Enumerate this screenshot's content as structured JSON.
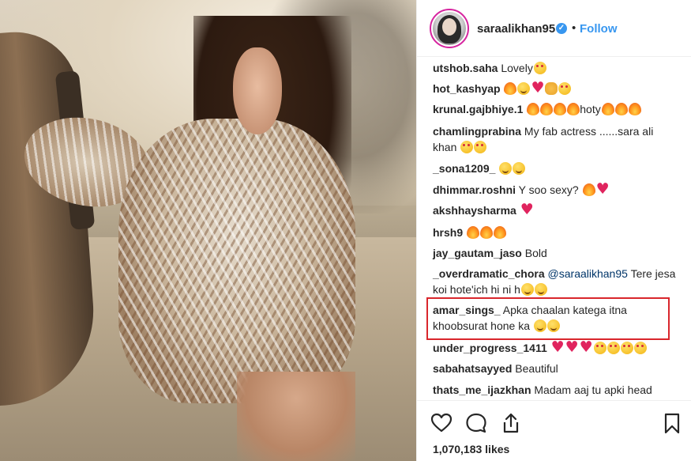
{
  "post": {
    "username": "saraalikhan95",
    "verified_mark": "✓",
    "separator": "•",
    "follow_label": "Follow",
    "likes": "1,070,183 likes"
  },
  "comments": [
    {
      "user": "utshob.saha",
      "text": "Lovely",
      "emoji": [
        "smile"
      ]
    },
    {
      "user": "hot_kashyap",
      "text": "",
      "emoji": [
        "fire",
        "wink",
        "heart",
        "ok",
        "smile"
      ]
    },
    {
      "user": "krunal.gajbhiye.1",
      "text_parts": [
        "",
        "hoty"
      ],
      "emoji_groups": [
        [
          "fire",
          "fire",
          "fire",
          "fire"
        ],
        [
          "fire",
          "fire",
          "fire"
        ]
      ]
    },
    {
      "user": "chamlingprabina",
      "text": "My fab actress ......sara ali khan",
      "emoji": [
        "smile",
        "smile"
      ]
    },
    {
      "user": "_sona1209_",
      "text": "",
      "emoji": [
        "wink",
        "wink"
      ]
    },
    {
      "user": "dhimmar.roshni",
      "text": "Y soo sexy?",
      "emoji": [
        "fire",
        "heart"
      ]
    },
    {
      "user": "akshhaysharma",
      "text": "",
      "emoji": [
        "heart"
      ]
    },
    {
      "user": "hrsh9",
      "text": "",
      "emoji": [
        "fire",
        "fire",
        "fire"
      ]
    },
    {
      "user": "jay_gautam_jaso",
      "text": "Bold",
      "emoji": []
    },
    {
      "user": "_overdramatic_chora",
      "mention": "@saraalikhan95",
      "text": "Tere jesa koi hote'ich hi ni h",
      "emoji": [
        "wink",
        "wink"
      ]
    },
    {
      "user": "amar_sings_",
      "text": "Apka chaalan katega itna khoobsurat hone ka",
      "emoji": [
        "wink",
        "wink"
      ]
    },
    {
      "user": "under_progress_1411",
      "text": "",
      "emoji": [
        "heart",
        "heart",
        "heart",
        "smile",
        "smile",
        "smile",
        "smile"
      ]
    },
    {
      "user": "sabahatsayyed",
      "text": "Beautiful",
      "emoji": []
    },
    {
      "user": "thats_me_ijazkhan",
      "text": "Madam aaj tu apki head",
      "emoji": []
    }
  ],
  "icons": {
    "like": "heart-outline-icon",
    "comment": "speech-bubble-icon",
    "share": "share-icon",
    "save": "bookmark-icon"
  },
  "colors": {
    "link": "#3897f0",
    "highlight": "#d9262c",
    "heart": "#e0245e"
  }
}
